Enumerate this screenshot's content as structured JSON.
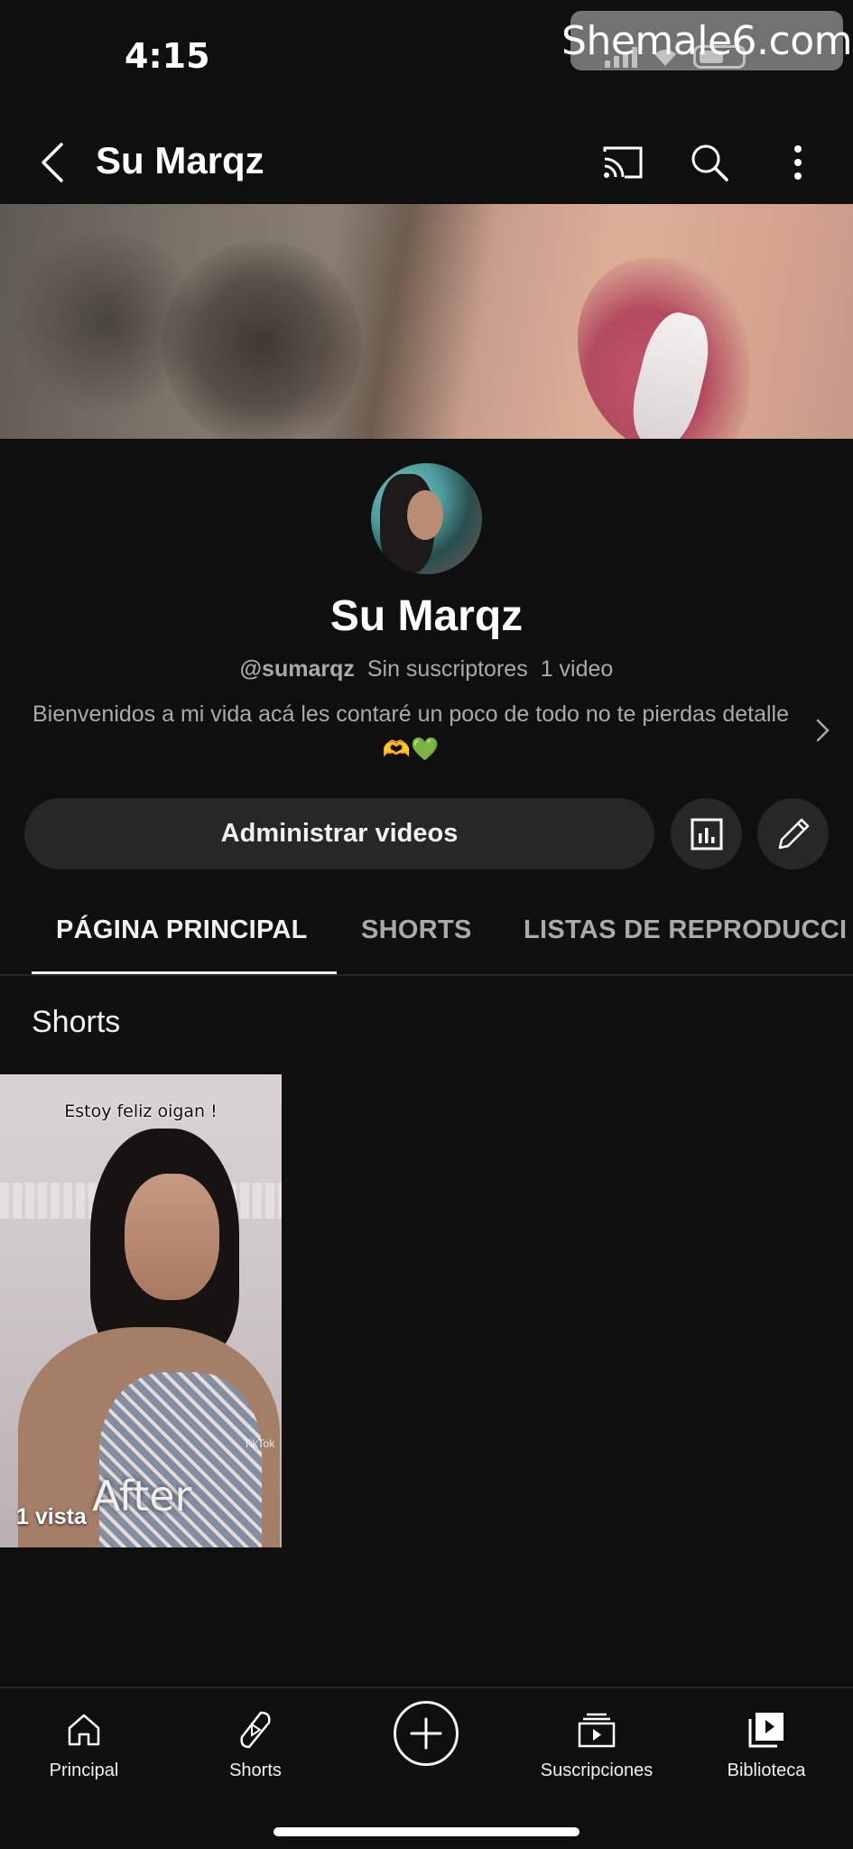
{
  "status_bar": {
    "time": "4:15"
  },
  "watermark": "Shemale6.com",
  "app_bar": {
    "title": "Su Marqz"
  },
  "channel": {
    "name": "Su Marqz",
    "handle": "@sumarqz",
    "subscribers": "Sin suscriptores",
    "video_count": "1 video",
    "description": "Bienvenidos a mi vida acá les contaré un poco de todo no te pierdas detalle 🫶💚"
  },
  "actions": {
    "manage_label": "Administrar videos"
  },
  "tabs": [
    {
      "label": "PÁGINA PRINCIPAL",
      "active": true
    },
    {
      "label": "SHORTS",
      "active": false
    },
    {
      "label": "LISTAS DE REPRODUCCI",
      "active": false
    }
  ],
  "section": {
    "title": "Shorts"
  },
  "shorts": [
    {
      "caption": "Estoy feliz  oigan !",
      "overlay_text": "After",
      "views": "1 vista",
      "badge": "TikTok"
    }
  ],
  "bottom_nav": [
    {
      "label": "Principal",
      "icon": "home-icon"
    },
    {
      "label": "Shorts",
      "icon": "shorts-icon"
    },
    {
      "label": "",
      "icon": "create-icon"
    },
    {
      "label": "Suscripciones",
      "icon": "subscriptions-icon"
    },
    {
      "label": "Biblioteca",
      "icon": "library-icon"
    }
  ],
  "colors": {
    "background": "#0f0f0f",
    "surface": "#272727",
    "text": "#f1f1f1",
    "secondary_text": "#aaaaaa",
    "accent": "#ffffff"
  }
}
